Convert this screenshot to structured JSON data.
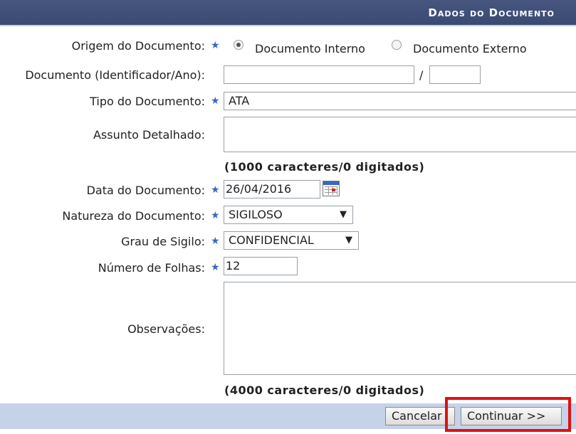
{
  "header": {
    "title": "Dados do Documento"
  },
  "form": {
    "origem": {
      "label": "Origem do Documento:",
      "options": [
        {
          "label": "Documento Interno",
          "checked": true
        },
        {
          "label": "Documento Externo",
          "checked": false
        }
      ]
    },
    "identificador": {
      "label": "Documento (Identificador/Ano):",
      "number": "",
      "separator": "/",
      "year": ""
    },
    "tipo": {
      "label": "Tipo do Documento:",
      "value": "ATA"
    },
    "assunto": {
      "label": "Assunto Detalhado:",
      "value": "",
      "counter": "(1000 caracteres/0 digitados)"
    },
    "data": {
      "label": "Data do Documento:",
      "value": "26/04/2016",
      "icon": "calendar-icon"
    },
    "natureza": {
      "label": "Natureza do Documento:",
      "value": "SIGILOSO"
    },
    "sigilo": {
      "label": "Grau de Sigilo:",
      "value": "CONFIDENCIAL"
    },
    "folhas": {
      "label": "Número de Folhas:",
      "value": "12"
    },
    "observacoes": {
      "label": "Observações:",
      "value": "",
      "counter": "(4000 caracteres/0 digitados)"
    },
    "required_marker": "★"
  },
  "footer": {
    "cancel_label": "Cancelar",
    "continue_label": "Continuar >>"
  },
  "colors": {
    "header_bg": "#3f4f78",
    "footer_bg": "#c6d2e8",
    "highlight": "#e01010",
    "required_star": "#3a66c4"
  }
}
